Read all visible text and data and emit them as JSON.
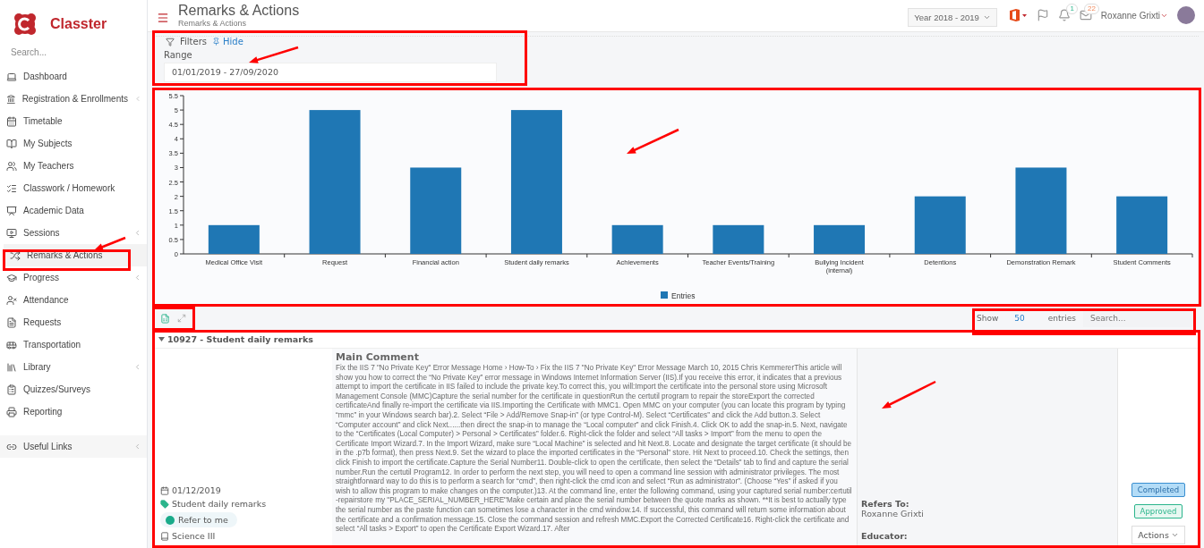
{
  "brand": {
    "name": "Classter"
  },
  "sidebar": {
    "search_placeholder": "Search...",
    "items": [
      {
        "label": "Dashboard",
        "selected": false,
        "expandable": false
      },
      {
        "label": "Registration & Enrollments",
        "selected": false,
        "expandable": true
      },
      {
        "label": "Timetable",
        "selected": false,
        "expandable": false
      },
      {
        "label": "My Subjects",
        "selected": false,
        "expandable": false
      },
      {
        "label": "My Teachers",
        "selected": false,
        "expandable": false
      },
      {
        "label": "Classwork / Homework",
        "selected": false,
        "expandable": false
      },
      {
        "label": "Academic Data",
        "selected": false,
        "expandable": false
      },
      {
        "label": "Sessions",
        "selected": false,
        "expandable": true
      },
      {
        "label": "Remarks & Actions",
        "selected": true,
        "expandable": false
      },
      {
        "label": "Progress",
        "selected": false,
        "expandable": true
      },
      {
        "label": "Attendance",
        "selected": false,
        "expandable": false
      },
      {
        "label": "Requests",
        "selected": false,
        "expandable": false
      },
      {
        "label": "Transportation",
        "selected": false,
        "expandable": false
      },
      {
        "label": "Library",
        "selected": false,
        "expandable": true
      },
      {
        "label": "Quizzes/Surveys",
        "selected": false,
        "expandable": false
      },
      {
        "label": "Reporting",
        "selected": false,
        "expandable": false
      }
    ],
    "links": {
      "label": "Useful Links",
      "expandable": true
    }
  },
  "header": {
    "title": "Remarks & Actions",
    "breadcrumb": "Remarks & Actions",
    "year": "Year 2018 - 2019",
    "notifications": "1",
    "messages": "22",
    "user": "Roxanne Grixti"
  },
  "filters": {
    "label": "Filters",
    "hide": "Hide",
    "range_label": "Range",
    "range_value": "01/01/2019 - 27/09/2020"
  },
  "chart_data": {
    "type": "bar",
    "categories": [
      "Medical Office Visit",
      "Request",
      "Financial action",
      "Student daily remarks",
      "Achievements",
      "Teacher Events/Training",
      "Bullying Incident (internal)",
      "Detentions",
      "Demonstration Remark",
      "Student Comments"
    ],
    "series": [
      {
        "name": "Entries",
        "color": "#1f77b4",
        "values": [
          1,
          5,
          3,
          5,
          1,
          1,
          1,
          2,
          3,
          2
        ]
      }
    ],
    "ylim": [
      0,
      5.5
    ],
    "yticks": [
      0,
      0.5,
      1,
      1.5,
      2,
      2.5,
      3,
      3.5,
      4,
      4.5,
      5,
      5.5
    ]
  },
  "table": {
    "show": "Show",
    "page_size": "50",
    "entries": "entries",
    "search_placeholder": "Search..."
  },
  "record": {
    "group": "10927 - Student daily remarks",
    "expanded": true,
    "date": "01/12/2019",
    "category": "Student daily remarks",
    "refer_button": "Refer to me",
    "subject": "Science III",
    "comment_title": "Main Comment",
    "comment": "Fix the IIS 7 \"No Private Key\" Error Message Home › How-To › Fix the IIS 7 \"No Private Key\" Error Message March 10, 2015 Chris KemmererThis article will show you how to correct the “No Private Key” error message in Windows Internet Information Server (IIS).If you receive this error, it indicates that a previous attempt to import the certificate in IIS failed to include the private key.To correct this, you will:Import the certificate into the personal store using Microsoft Management Console (MMC)Capture the serial number for the certificate in questionRun the certutil program to repair the storeExport the corrected certificateAnd finally re-import the certificate via IIS.Importing the Certificate with MMC1. Open MMC on your computer (you can locate this program by typing “mmc” in your Windows search bar).2. Select “File > Add/Remove Snap-in” (or type Control-M). Select “Certificates” and click the Add button.3. Select “Computer account” and click Next......then direct the snap-in to manage the “Local computer” and click Finish.4. Click OK to add the snap-in.5. Next, navigate to the “Certificates (Local Computer) > Personal > Certificates” folder.6. Right-click the folder and select “All tasks > Import” from the menu to open the Certificate Import Wizard.7. In the Import Wizard, make sure “Local Machine” is selected and hit Next.8. Locate and designate the target certificate (it should be in the .p7b format), then press Next.9. Set the wizard to place the imported certificates in the “Personal” store. Hit Next to proceed.10. Check the settings, then click Finish to import the certificate.Capture the Serial Number11. Double-click to open the certificate, then select the “Details” tab to find and capture the serial number.Run the certutil Program12. In order to perform the next step, you will need to open a command line session with administrator privileges. The most straightforward way to do this is to perform a search for “cmd”, then right-click the cmd icon and select “Run as administrator”. (Choose “Yes” if asked if you wish to allow this program to make changes on the computer.)13. At the command line, enter the following command, using your captured serial number:certutil -repairstore my \"PLACE_SERIAL_NUMBER_HERE\"Make certain and place the serial number between the quote marks as shown.  **It is best to actually type the serial number as the paste function can sometimes lose a character in the cmd window.14. If successful, this command will return some information about the certificate and a confirmation message.15. Close the command session and refresh MMC.Export the Corrected Certificate16. Right-click the certificate and select “All tasks > Export” to open the Certificate Export Wizard.17. After",
    "refers_label": "Refers To:",
    "refers_value": "Roxanne Grixti",
    "educator_label": "Educator:",
    "statuses": [
      {
        "label": "Completed",
        "kind": "info"
      },
      {
        "label": "Approved",
        "kind": "success"
      }
    ],
    "actions": "Actions"
  }
}
